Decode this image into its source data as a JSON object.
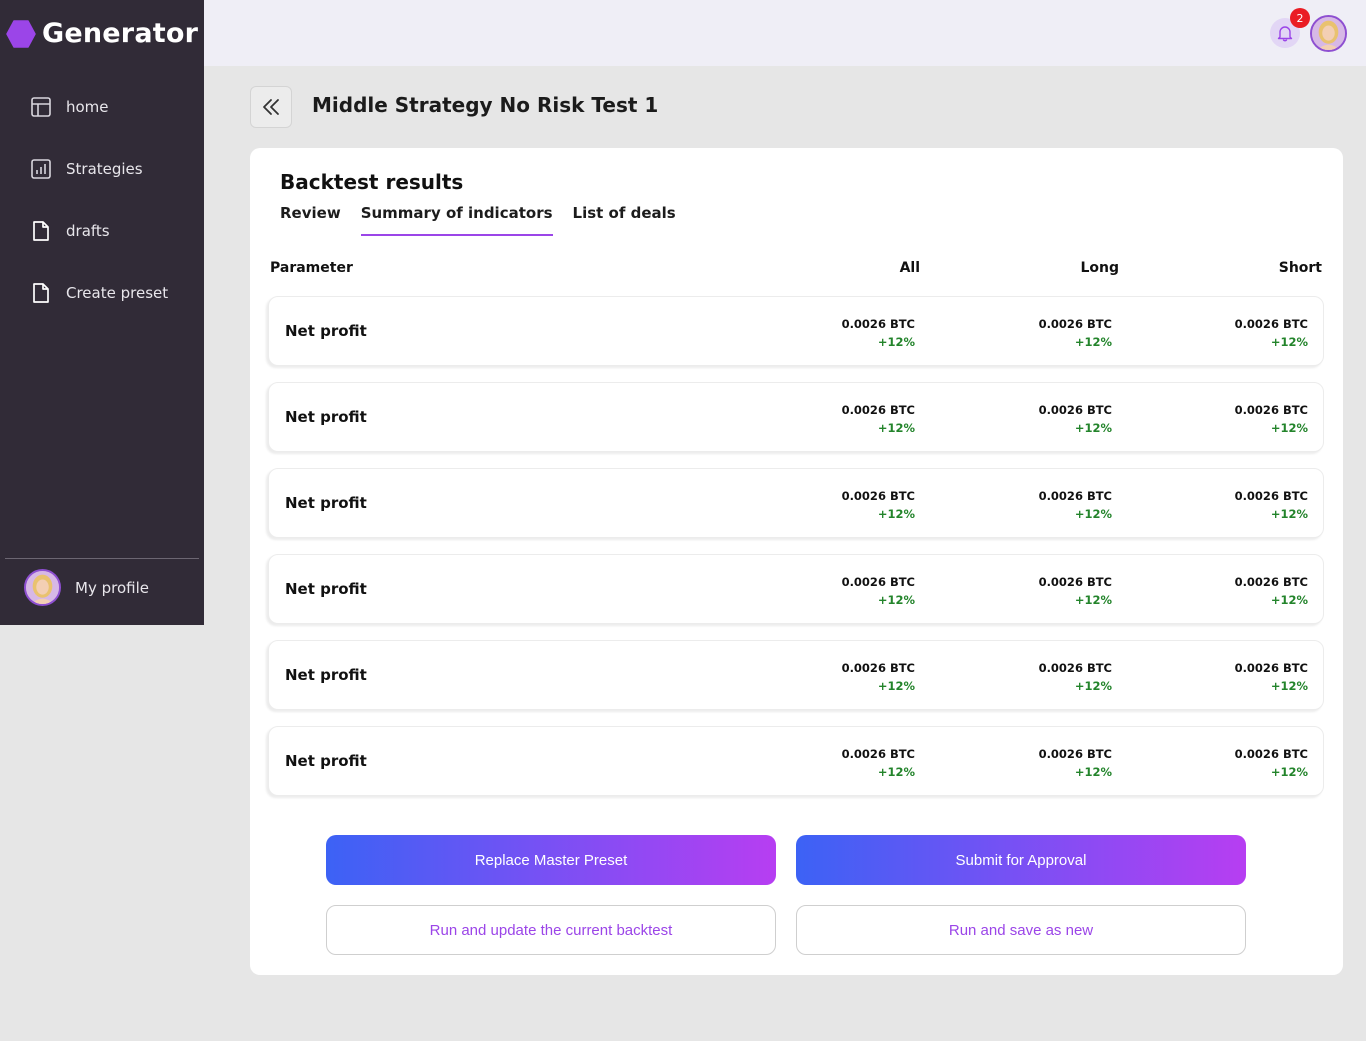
{
  "app": {
    "name": "Generator"
  },
  "sidebar": {
    "items": [
      {
        "label": "home",
        "icon": "layout-icon"
      },
      {
        "label": "Strategies",
        "icon": "bar-chart-icon"
      },
      {
        "label": "drafts",
        "icon": "document-icon"
      },
      {
        "label": "Create preset",
        "icon": "document-icon"
      }
    ],
    "profile_label": "My profile"
  },
  "topbar": {
    "notification_count": "2"
  },
  "page": {
    "title": "Middle Strategy No Risk Test 1"
  },
  "backtest": {
    "title": "Backtest results",
    "tabs": [
      {
        "label": "Review",
        "active": false
      },
      {
        "label": "Summary of indicators",
        "active": true
      },
      {
        "label": "List of deals",
        "active": false
      }
    ],
    "columns": {
      "param": "Parameter",
      "all": "All",
      "long": "Long",
      "short": "Short"
    },
    "rows": [
      {
        "label": "Net profit",
        "all": {
          "value": "0.0026 BTC",
          "pct": "+12%"
        },
        "long": {
          "value": "0.0026 BTC",
          "pct": "+12%"
        },
        "short": {
          "value": "0.0026 BTC",
          "pct": "+12%"
        }
      },
      {
        "label": "Net profit",
        "all": {
          "value": "0.0026 BTC",
          "pct": "+12%"
        },
        "long": {
          "value": "0.0026 BTC",
          "pct": "+12%"
        },
        "short": {
          "value": "0.0026 BTC",
          "pct": "+12%"
        }
      },
      {
        "label": "Net profit",
        "all": {
          "value": "0.0026 BTC",
          "pct": "+12%"
        },
        "long": {
          "value": "0.0026 BTC",
          "pct": "+12%"
        },
        "short": {
          "value": "0.0026 BTC",
          "pct": "+12%"
        }
      },
      {
        "label": "Net profit",
        "all": {
          "value": "0.0026 BTC",
          "pct": "+12%"
        },
        "long": {
          "value": "0.0026 BTC",
          "pct": "+12%"
        },
        "short": {
          "value": "0.0026 BTC",
          "pct": "+12%"
        }
      },
      {
        "label": "Net profit",
        "all": {
          "value": "0.0026 BTC",
          "pct": "+12%"
        },
        "long": {
          "value": "0.0026 BTC",
          "pct": "+12%"
        },
        "short": {
          "value": "0.0026 BTC",
          "pct": "+12%"
        }
      },
      {
        "label": "Net profit",
        "all": {
          "value": "0.0026 BTC",
          "pct": "+12%"
        },
        "long": {
          "value": "0.0026 BTC",
          "pct": "+12%"
        },
        "short": {
          "value": "0.0026 BTC",
          "pct": "+12%"
        }
      }
    ]
  },
  "actions": {
    "replace": "Replace Master Preset",
    "submit": "Submit for Approval",
    "run_update": "Run and update the current backtest",
    "run_save": "Run and save as new"
  },
  "colors": {
    "sidebar_bg": "#312b37",
    "accent": "#9b45e8",
    "gradient_start": "#3c62f5",
    "gradient_end": "#b73ef2",
    "positive": "#23842b",
    "badge": "#ea1c24"
  }
}
